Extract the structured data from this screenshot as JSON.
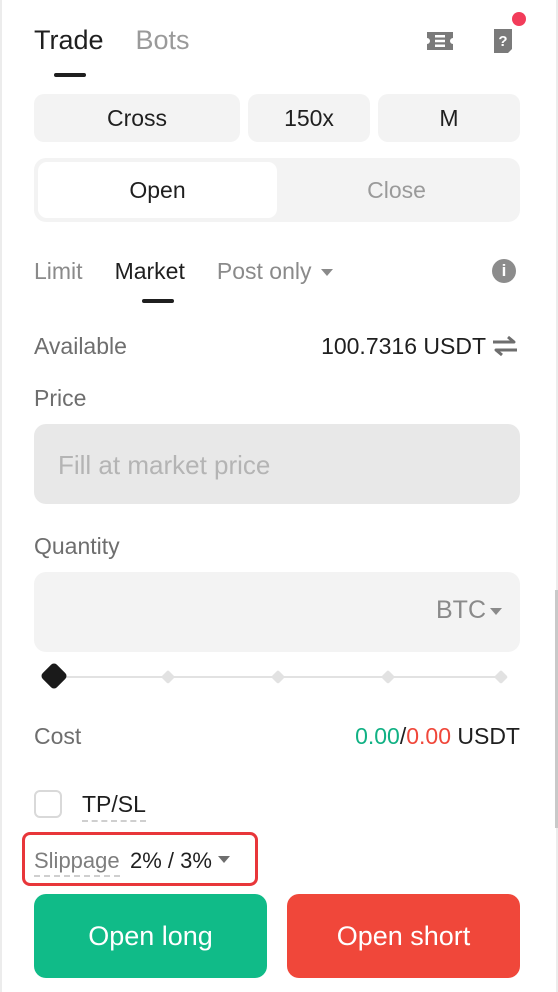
{
  "header": {
    "tabs": [
      {
        "label": "Trade",
        "active": true
      },
      {
        "label": "Bots",
        "active": false
      }
    ],
    "icons": [
      "ticket-icon",
      "help-doc-icon"
    ],
    "has_notification": true
  },
  "margin": {
    "mode": "Cross",
    "leverage": "150x",
    "size": "M"
  },
  "position_toggle": {
    "open": "Open",
    "close": "Close",
    "selected": "Open"
  },
  "order_types": {
    "limit": "Limit",
    "market": "Market",
    "post_only": "Post only",
    "selected": "Market"
  },
  "available": {
    "label": "Available",
    "value": "100.7316 USDT"
  },
  "price": {
    "label": "Price",
    "placeholder": "Fill at market price"
  },
  "quantity": {
    "label": "Quantity",
    "value": "",
    "unit": "BTC",
    "slider_fraction": 0
  },
  "cost": {
    "label": "Cost",
    "long": "0.00",
    "separator": "/",
    "short": "0.00",
    "unit": "USDT"
  },
  "tpsl": {
    "label": "TP/SL",
    "checked": false
  },
  "slippage": {
    "label": "Slippage",
    "value": "2% / 3%"
  },
  "actions": {
    "open_long": "Open long",
    "open_short": "Open short"
  },
  "colors": {
    "long": "#10bb88",
    "short": "#f0473a",
    "highlight": "#e8363a"
  }
}
